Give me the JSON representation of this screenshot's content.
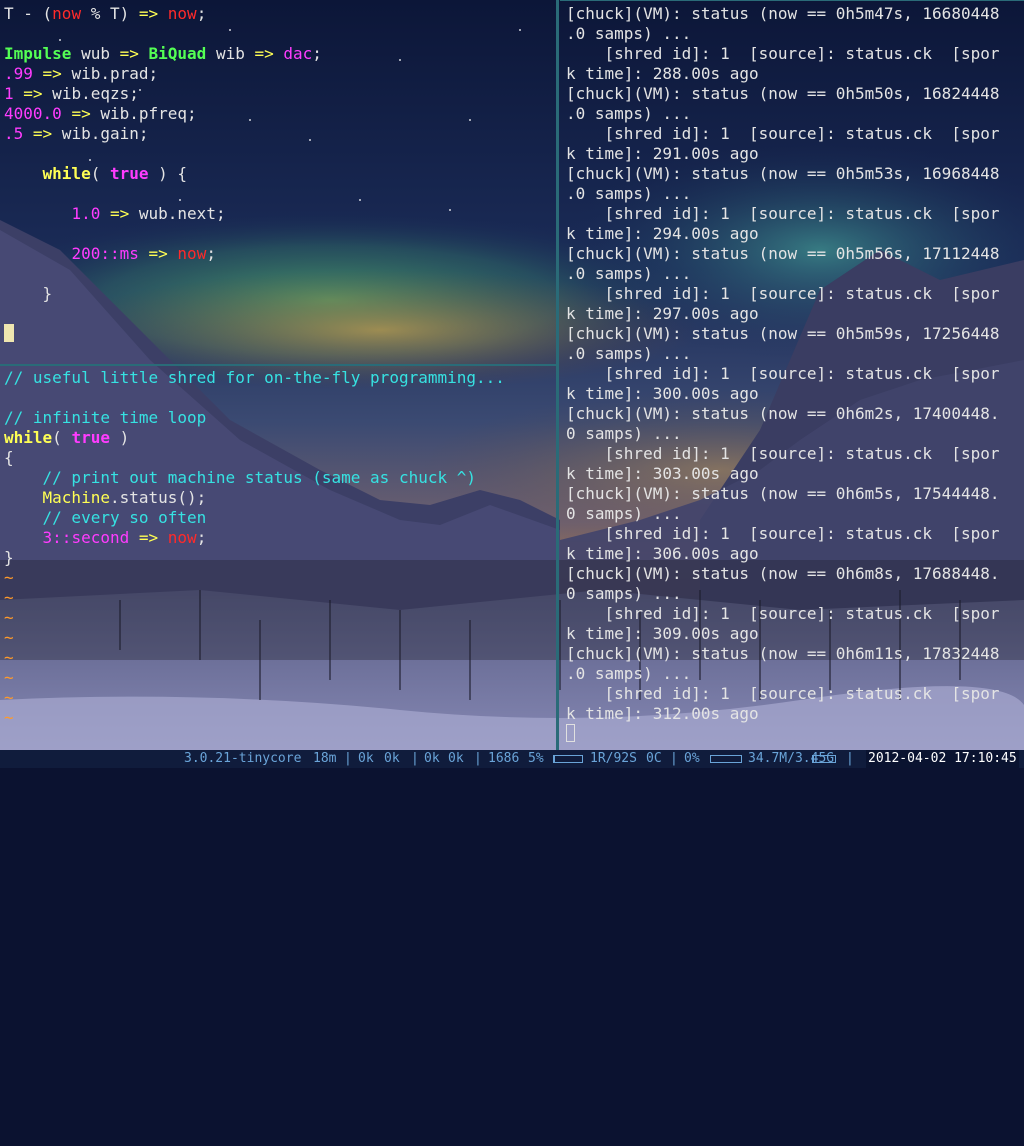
{
  "colors": {
    "keyword": "#ffff54",
    "ugen": "#54ff54",
    "number": "#ff3cff",
    "now": "#ff2a2a",
    "comment": "#36e2e2",
    "tilde": "#ff9a2a",
    "console_text": "#e4e4e4",
    "status_text": "#6aa4d8"
  },
  "editor_top": {
    "line1": {
      "a": "T - (",
      "b": "now",
      "c": " % T) ",
      "d": "=>",
      "e": " ",
      "f": "now",
      "g": ";"
    },
    "line3": {
      "a": "Impulse",
      "b": " wub ",
      "c": "=>",
      "d": " ",
      "e": "BiQuad",
      "f": " wib ",
      "g": "=>",
      "h": " ",
      "i": "dac",
      "j": ";"
    },
    "line4": {
      "a": ".99",
      "b": " ",
      "c": "=>",
      "d": " wib.prad;"
    },
    "line5": {
      "a": "1",
      "b": " ",
      "c": "=>",
      "d": " wib.eqzs;"
    },
    "line6": {
      "a": "4000.0",
      "b": " ",
      "c": "=>",
      "d": " wib.pfreq;"
    },
    "line7": {
      "a": ".5",
      "b": " ",
      "c": "=>",
      "d": " wib.gain;"
    },
    "line9": {
      "indent": "    ",
      "a": "while",
      "b": "( ",
      "c": "true",
      "d": " ) {"
    },
    "line11": {
      "indent": "       ",
      "a": "1.0",
      "b": " ",
      "c": "=>",
      "d": " wub.next;"
    },
    "line13": {
      "indent": "       ",
      "a": "200",
      "b": "::",
      "c": "ms",
      "d": " ",
      "e": "=>",
      "f": " ",
      "g": "now",
      "h": ";"
    },
    "line15": {
      "indent": "    ",
      "a": "}"
    }
  },
  "editor_bottom": {
    "line1": "// useful little shred for on-the-fly programming...",
    "line3": "// infinite time loop",
    "line4": {
      "a": "while",
      "b": "( ",
      "c": "true",
      "d": " )"
    },
    "line5": "{",
    "line6": {
      "indent": "    ",
      "a": "// print out machine status (same as chuck ^)"
    },
    "line7": {
      "indent": "    ",
      "a": "Machine",
      "b": ".status();"
    },
    "line8": {
      "indent": "    ",
      "a": "// every so often"
    },
    "line9": {
      "indent": "    ",
      "a": "3",
      "b": "::",
      "c": "second",
      "d": " ",
      "e": "=>",
      "f": " ",
      "g": "now",
      "h": ";"
    },
    "line10": "}",
    "tilde": "~",
    "tilde_count": 8
  },
  "console": {
    "lines": [
      "[chuck](VM): status (now == 0h5m47s, 16680448",
      ".0 samps) ...",
      "    [shred id]: 1  [source]: status.ck  [spor",
      "k time]: 288.00s ago",
      "[chuck](VM): status (now == 0h5m50s, 16824448",
      ".0 samps) ...",
      "    [shred id]: 1  [source]: status.ck  [spor",
      "k time]: 291.00s ago",
      "[chuck](VM): status (now == 0h5m53s, 16968448",
      ".0 samps) ...",
      "    [shred id]: 1  [source]: status.ck  [spor",
      "k time]: 294.00s ago",
      "[chuck](VM): status (now == 0h5m56s, 17112448",
      ".0 samps) ...",
      "    [shred id]: 1  [source]: status.ck  [spor",
      "k time]: 297.00s ago",
      "[chuck](VM): status (now == 0h5m59s, 17256448",
      ".0 samps) ...",
      "    [shred id]: 1  [source]: status.ck  [spor",
      "k time]: 300.00s ago",
      "[chuck](VM): status (now == 0h6m2s, 17400448.",
      "0 samps) ...",
      "    [shred id]: 1  [source]: status.ck  [spor",
      "k time]: 303.00s ago",
      "[chuck](VM): status (now == 0h6m5s, 17544448.",
      "0 samps) ...",
      "    [shred id]: 1  [source]: status.ck  [spor",
      "k time]: 306.00s ago",
      "[chuck](VM): status (now == 0h6m8s, 17688448.",
      "0 samps) ...",
      "    [shred id]: 1  [source]: status.ck  [spor",
      "k time]: 309.00s ago",
      "[chuck](VM): status (now == 0h6m11s, 17832448",
      ".0 samps) ...",
      "    [shred id]: 1  [source]: status.ck  [spor",
      "k time]: 312.00s ago"
    ]
  },
  "statusbar": {
    "kernel": "3.0.21-tinycore",
    "uptime": "18m",
    "net1": "0k",
    "net2": "0k",
    "net3": "0k",
    "net4": "0k",
    "cpu_freq": "1686",
    "cpu_pct": "5%",
    "cpu_fraction": 0.05,
    "load": "1R/92S",
    "temp": "0C",
    "swap_pct": "0%",
    "swap_fraction": 0.0,
    "mem": "34.7M/3.45G",
    "mem_fraction": 0.02,
    "datetime": "2012-04-02 17:10:45",
    "sep": "|"
  }
}
